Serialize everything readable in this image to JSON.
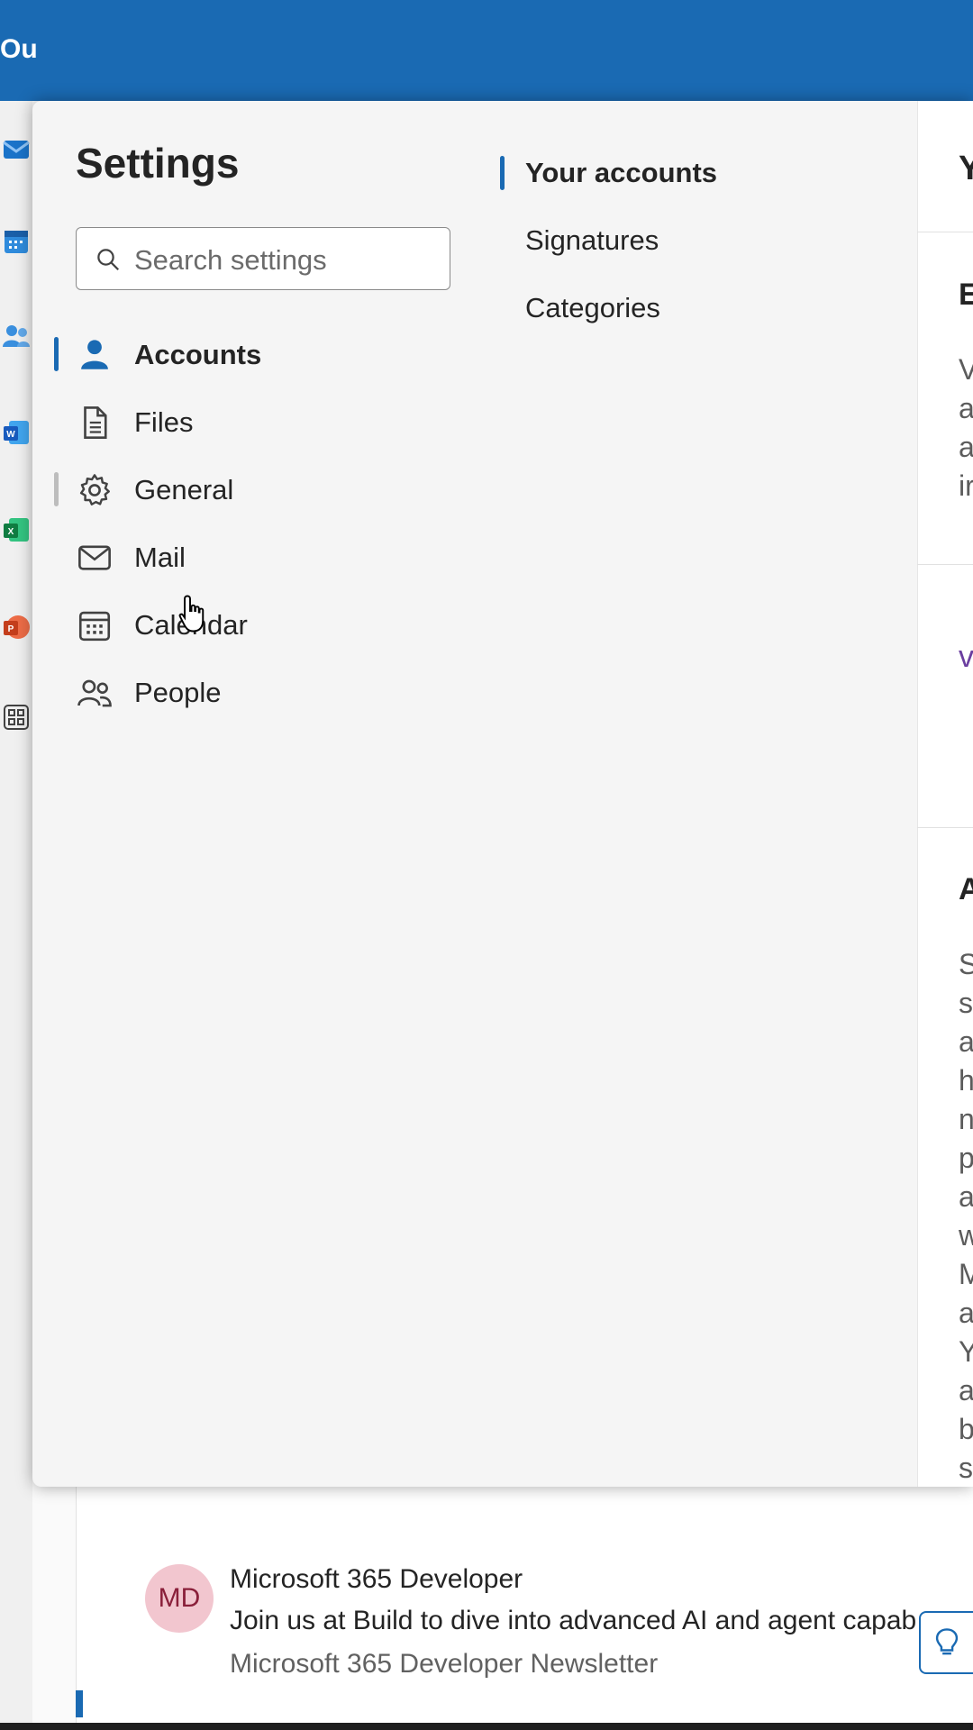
{
  "app": {
    "name_fragment": "Ou"
  },
  "settings": {
    "title": "Settings",
    "search": {
      "placeholder": "Search settings"
    },
    "nav": [
      {
        "label": "Accounts",
        "icon": "person-icon",
        "selected": true
      },
      {
        "label": "Files",
        "icon": "document-icon",
        "selected": false
      },
      {
        "label": "General",
        "icon": "gear-icon",
        "selected": false,
        "hovered": true
      },
      {
        "label": "Mail",
        "icon": "mail-icon",
        "selected": false
      },
      {
        "label": "Calendar",
        "icon": "calendar-icon",
        "selected": false
      },
      {
        "label": "People",
        "icon": "people-icon",
        "selected": false
      }
    ],
    "subnav": [
      {
        "label": "Your accounts",
        "selected": true
      },
      {
        "label": "Signatures",
        "selected": false
      },
      {
        "label": "Categories",
        "selected": false
      }
    ],
    "content_fragments": {
      "heading_1": "Y",
      "section_heading_1": "E",
      "section_1_lines": [
        "V",
        "a",
        "a",
        "ir"
      ],
      "section_heading_2": "A",
      "section_2_lines": [
        "S",
        "s",
        "a",
        "h",
        "n",
        "p",
        "a",
        "w",
        "M",
        "a",
        "Y",
        "a",
        "b",
        "s"
      ]
    }
  },
  "mail_item": {
    "avatar_initials": "MD",
    "sender": "Microsoft 365 Developer",
    "preview": "Join us at Build to dive into advanced AI and agent capab",
    "newsletter": "Microsoft 365 Developer Newsletter"
  },
  "colors": {
    "accent": "#1a6ab3",
    "avatar_bg": "#f2c6cf",
    "avatar_text": "#8a1f3a"
  }
}
